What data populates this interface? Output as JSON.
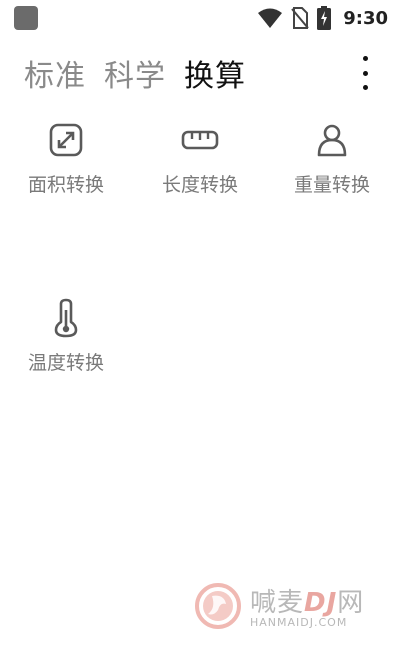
{
  "status_bar": {
    "time": "9:30",
    "icons": [
      "wifi-icon",
      "no-sim-icon",
      "battery-charging-icon"
    ]
  },
  "tabs": [
    {
      "label": "标准",
      "active": false
    },
    {
      "label": "科学",
      "active": false
    },
    {
      "label": "换算",
      "active": true
    }
  ],
  "more_icon": "more-vertical-icon",
  "converters": [
    {
      "label": "面积转换",
      "icon": "area-icon"
    },
    {
      "label": "长度转换",
      "icon": "ruler-icon"
    },
    {
      "label": "重量转换",
      "icon": "weight-icon"
    },
    {
      "label": "温度转换",
      "icon": "thermometer-icon"
    }
  ],
  "watermark": {
    "title_prefix": "喊麦",
    "title_dj": "DJ",
    "title_suffix": "网",
    "subtitle": "HANMAIDJ.COM"
  },
  "colors": {
    "active_tab": "#111111",
    "inactive_tab": "#8a8a8a",
    "icon_stroke": "#5a5a5a",
    "label": "#7a7a7a",
    "watermark_accent": "#e9a6a0"
  }
}
